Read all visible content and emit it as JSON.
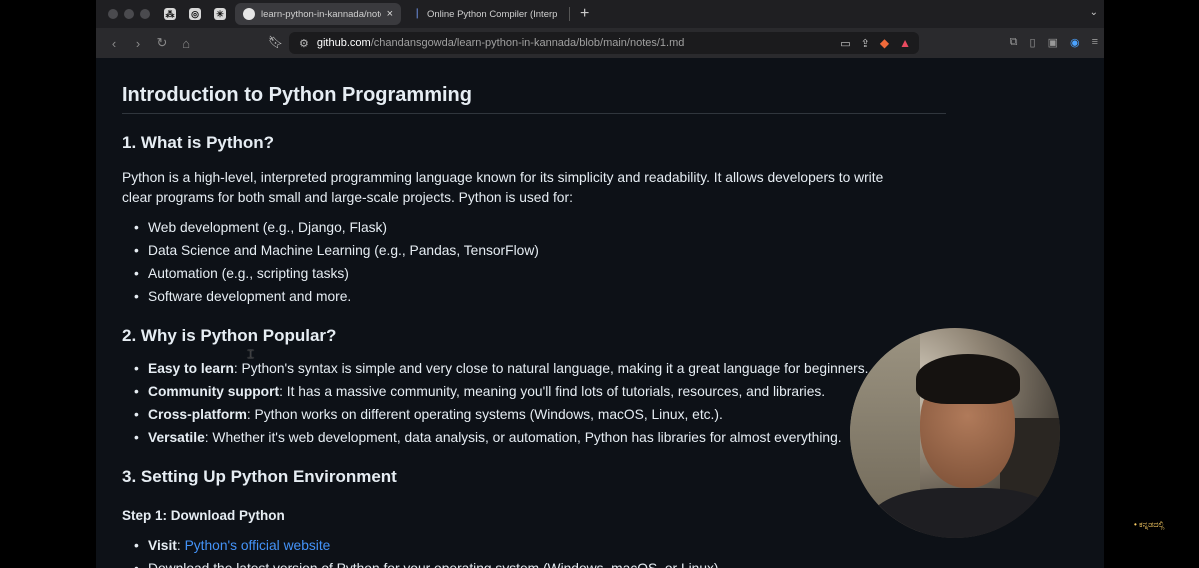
{
  "browser": {
    "tabs": [
      {
        "title": "learn-python-in-kannada/notes",
        "active": true,
        "favicon": "github-icon"
      },
      {
        "title": "Online Python Compiler (Interpreter)",
        "active": false,
        "favicon": "programiz-icon"
      }
    ],
    "pinned_icons": [
      "perplexity-icon",
      "chatgpt-icon",
      "claude-icon"
    ],
    "url": {
      "host": "github.com",
      "path": "/chandansgowda/learn-python-in-kannada/blob/main/notes/1.md"
    },
    "new_tab": "+",
    "close_glyph": "×"
  },
  "doc": {
    "title": "Introduction to Python Programming",
    "section1": {
      "heading": "1. What is Python?",
      "paragraph": "Python is a high-level, interpreted programming language known for its simplicity and readability. It allows developers to write clear programs for both small and large-scale projects. Python is used for:",
      "items": [
        "Web development (e.g., Django, Flask)",
        "Data Science and Machine Learning (e.g., Pandas, TensorFlow)",
        "Automation (e.g., scripting tasks)",
        "Software development and more."
      ]
    },
    "section2": {
      "heading": "2. Why is Python Popular?",
      "items": [
        {
          "term": "Easy to learn",
          "text": ": Python's syntax is simple and very close to natural language, making it a great language for beginners."
        },
        {
          "term": "Community support",
          "text": ": It has a massive community, meaning you'll find lots of tutorials, resources, and libraries."
        },
        {
          "term": "Cross-platform",
          "text": ": Python works on different operating systems (Windows, macOS, Linux, etc.)."
        },
        {
          "term": "Versatile",
          "text": ": Whether it's web development, data analysis, or automation, Python has libraries for almost everything."
        }
      ]
    },
    "section3": {
      "heading": "3. Setting Up Python Environment",
      "step1_heading": "Step 1: Download Python",
      "step1_items": [
        {
          "term": "Visit",
          "sep": ": ",
          "link": "Python's official website"
        },
        {
          "text": "Download the latest version of Python for your operating system (Windows, macOS, or Linux)."
        }
      ]
    }
  },
  "overlay": {
    "watermark": "• ಕನ್ನಡದಲ್ಲಿ"
  }
}
